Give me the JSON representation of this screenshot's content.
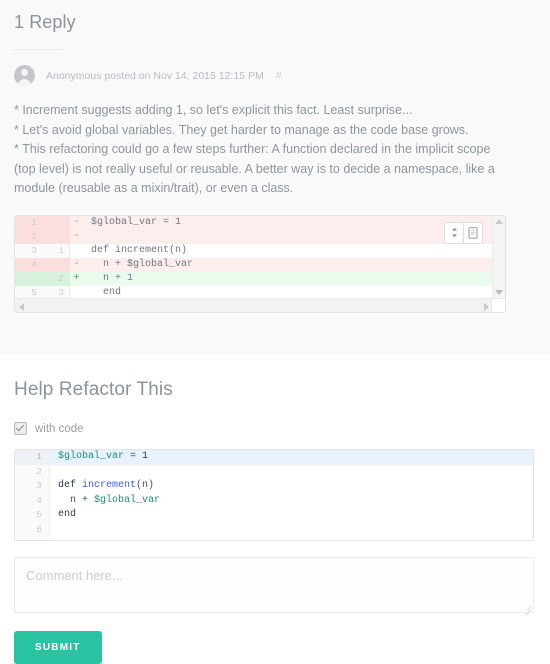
{
  "reply": {
    "heading": "1 Reply",
    "author": "Anonymous",
    "meta_text": "Anonymous posted on Nov 14, 2015 12:15 PM",
    "anchor": "#",
    "body_lines": [
      "* Increment suggests adding 1, so let's explicit this fact. Least surprise...",
      "* Let's avoid global variables. They get harder to manage as the code base grows.",
      "* This refactoring could go a few steps further: A function declared in the implicit scope (top level) is not really useful or reusable. A better way is to decide a namespace, like a module (reusable as a mixin/trait), or even a class."
    ]
  },
  "diff": {
    "tools": [
      {
        "icon": "sort-updown-icon",
        "title": ""
      },
      {
        "icon": "copy-document-icon",
        "title": ""
      }
    ],
    "rows": [
      {
        "old": "1",
        "new": "",
        "mark": "-",
        "code": "$global_var = 1",
        "type": "del"
      },
      {
        "old": "2",
        "new": "",
        "mark": "-",
        "code": "",
        "type": "del"
      },
      {
        "old": "3",
        "new": "1",
        "mark": "",
        "code": "def increment(n)",
        "type": "ctx"
      },
      {
        "old": "4",
        "new": "",
        "mark": "-",
        "code": "  n + $global_var",
        "type": "del"
      },
      {
        "old": "",
        "new": "2",
        "mark": "+",
        "code": "  n + 1",
        "type": "add"
      },
      {
        "old": "5",
        "new": "3",
        "mark": "",
        "code": "  end",
        "type": "ctx"
      }
    ]
  },
  "form": {
    "heading": "Help Refactor This",
    "checkbox_label": "with code",
    "checkbox_checked": true,
    "editor": {
      "lines": [
        {
          "n": "1",
          "active": true,
          "tokens": [
            {
              "t": "$global_var",
              "c": "tok-var"
            },
            {
              "t": " = ",
              "c": "tok-plain"
            },
            {
              "t": "1",
              "c": "tok-num"
            }
          ]
        },
        {
          "n": "2",
          "active": false,
          "tokens": []
        },
        {
          "n": "3",
          "active": false,
          "tokens": [
            {
              "t": "def ",
              "c": "tok-kw"
            },
            {
              "t": "increment",
              "c": "tok-fn"
            },
            {
              "t": "(n)",
              "c": "tok-plain"
            }
          ]
        },
        {
          "n": "4",
          "active": false,
          "tokens": [
            {
              "t": "  n + ",
              "c": "tok-plain"
            },
            {
              "t": "$global_var",
              "c": "tok-var"
            }
          ]
        },
        {
          "n": "5",
          "active": false,
          "tokens": [
            {
              "t": "end",
              "c": "tok-kw"
            }
          ]
        },
        {
          "n": "6",
          "active": false,
          "tokens": []
        }
      ]
    },
    "comment_placeholder": "Comment here...",
    "comment_value": "",
    "submit_label": "SUBMIT"
  },
  "colors": {
    "accent": "#29c3a2",
    "page_bg": "#f9f9fa",
    "text": "#8d969d",
    "diff_add_bg": "#eafbee",
    "diff_del_bg": "#fdeeee",
    "editor_active_bg": "#e8f2fd"
  }
}
